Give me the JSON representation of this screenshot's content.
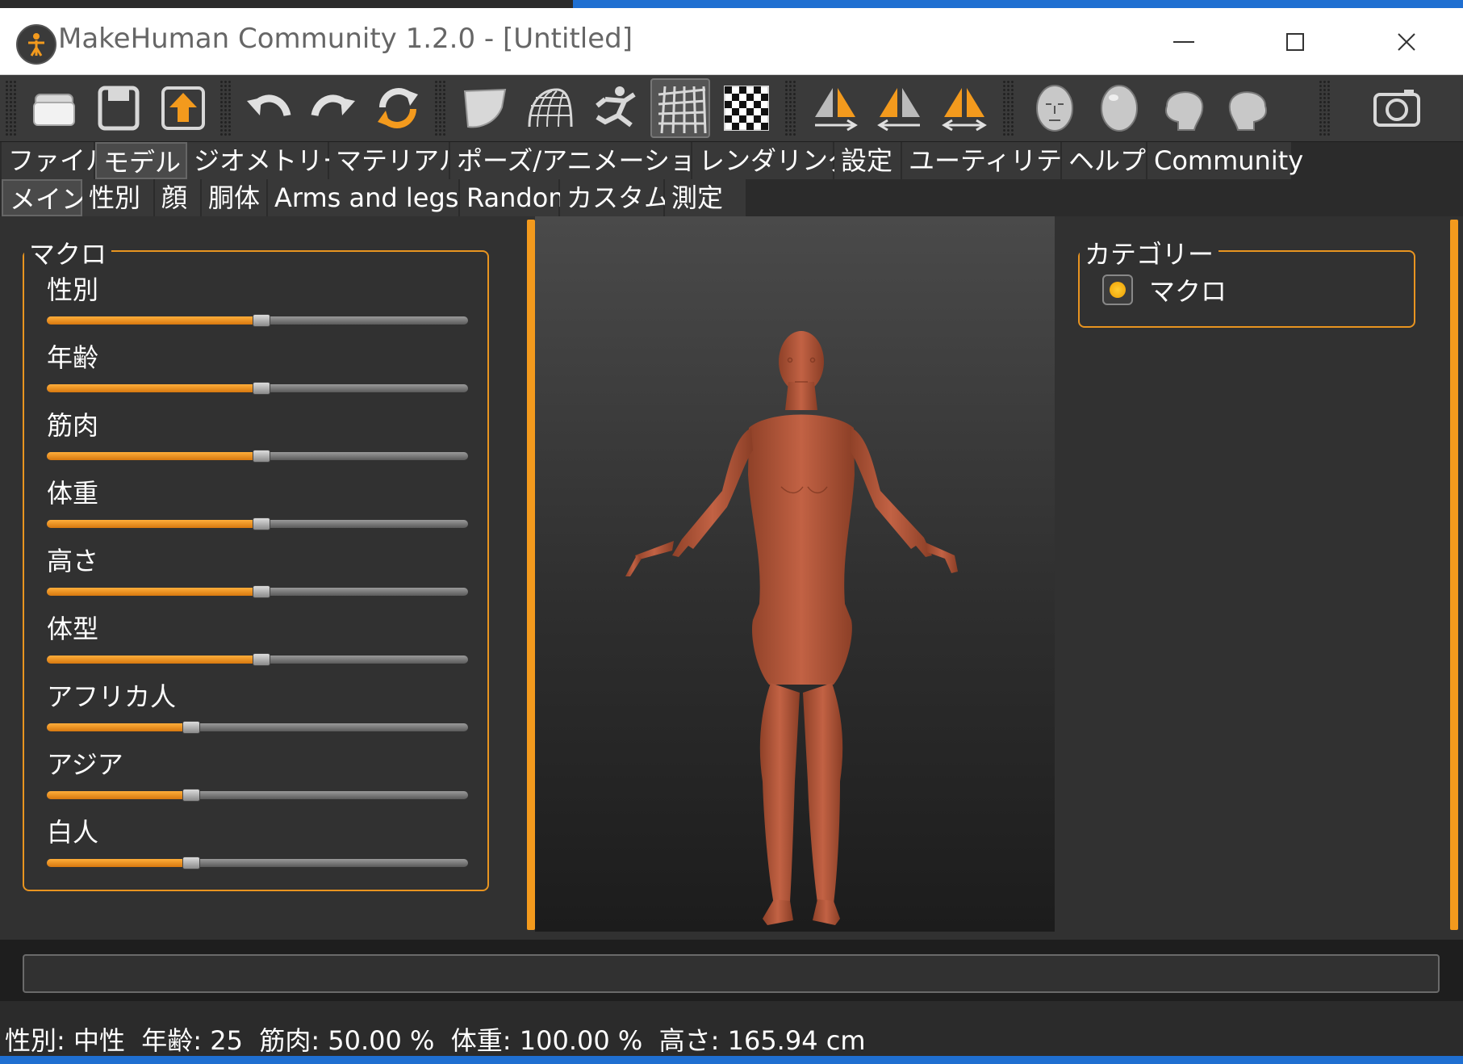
{
  "window": {
    "title": "MakeHuman Community 1.2.0 - [Untitled]"
  },
  "toolbar": {
    "buttons": [
      {
        "icon": "folder-open-icon"
      },
      {
        "icon": "save-icon"
      },
      {
        "icon": "export-icon"
      },
      {
        "icon": "undo-icon"
      },
      {
        "icon": "redo-icon"
      },
      {
        "icon": "reset-icon"
      },
      {
        "icon": "smooth-icon"
      },
      {
        "icon": "wireframe-icon"
      },
      {
        "icon": "pose-icon"
      },
      {
        "icon": "grid-icon"
      },
      {
        "icon": "background-icon"
      },
      {
        "icon": "symmetry-right-icon"
      },
      {
        "icon": "symmetry-left-icon"
      },
      {
        "icon": "symmetry-both-icon"
      },
      {
        "icon": "front-view-icon"
      },
      {
        "icon": "back-view-icon"
      },
      {
        "icon": "left-view-icon"
      },
      {
        "icon": "right-view-icon"
      },
      {
        "icon": "camera-icon"
      }
    ]
  },
  "main_tabs": [
    "ファイル",
    "モデル",
    "ジオメトリー",
    "マテリアル",
    "ポーズ/アニメーション",
    "レンダリング",
    "設定",
    "ユーティリティ",
    "ヘルプ",
    "Community"
  ],
  "main_tab_selected": "モデル",
  "sub_tabs": [
    "メイン",
    "性別",
    "顔",
    "胴体",
    "Arms and legs",
    "Random",
    "カスタム",
    "測定"
  ],
  "sub_tab_selected": "メイン",
  "macro": {
    "title": "マクロ",
    "sliders": [
      {
        "label": "性別",
        "value": 0.5
      },
      {
        "label": "年齢",
        "value": 0.5
      },
      {
        "label": "筋肉",
        "value": 0.5
      },
      {
        "label": "体重",
        "value": 0.5
      },
      {
        "label": "高さ",
        "value": 0.5
      },
      {
        "label": "体型",
        "value": 0.5
      },
      {
        "label": "アフリカ人",
        "value": 0.333
      },
      {
        "label": "アジア",
        "value": 0.333
      },
      {
        "label": "白人",
        "value": 0.333
      }
    ]
  },
  "category": {
    "title": "カテゴリー",
    "option": "マクロ",
    "checked": true
  },
  "status": "性別: 中性  年齢: 25  筋肉: 50.00 %  体重: 100.00 %  高さ: 165.94 cm",
  "colors": {
    "accent": "#f39a1d",
    "background": "#313131",
    "skin": "#b55a3a"
  }
}
